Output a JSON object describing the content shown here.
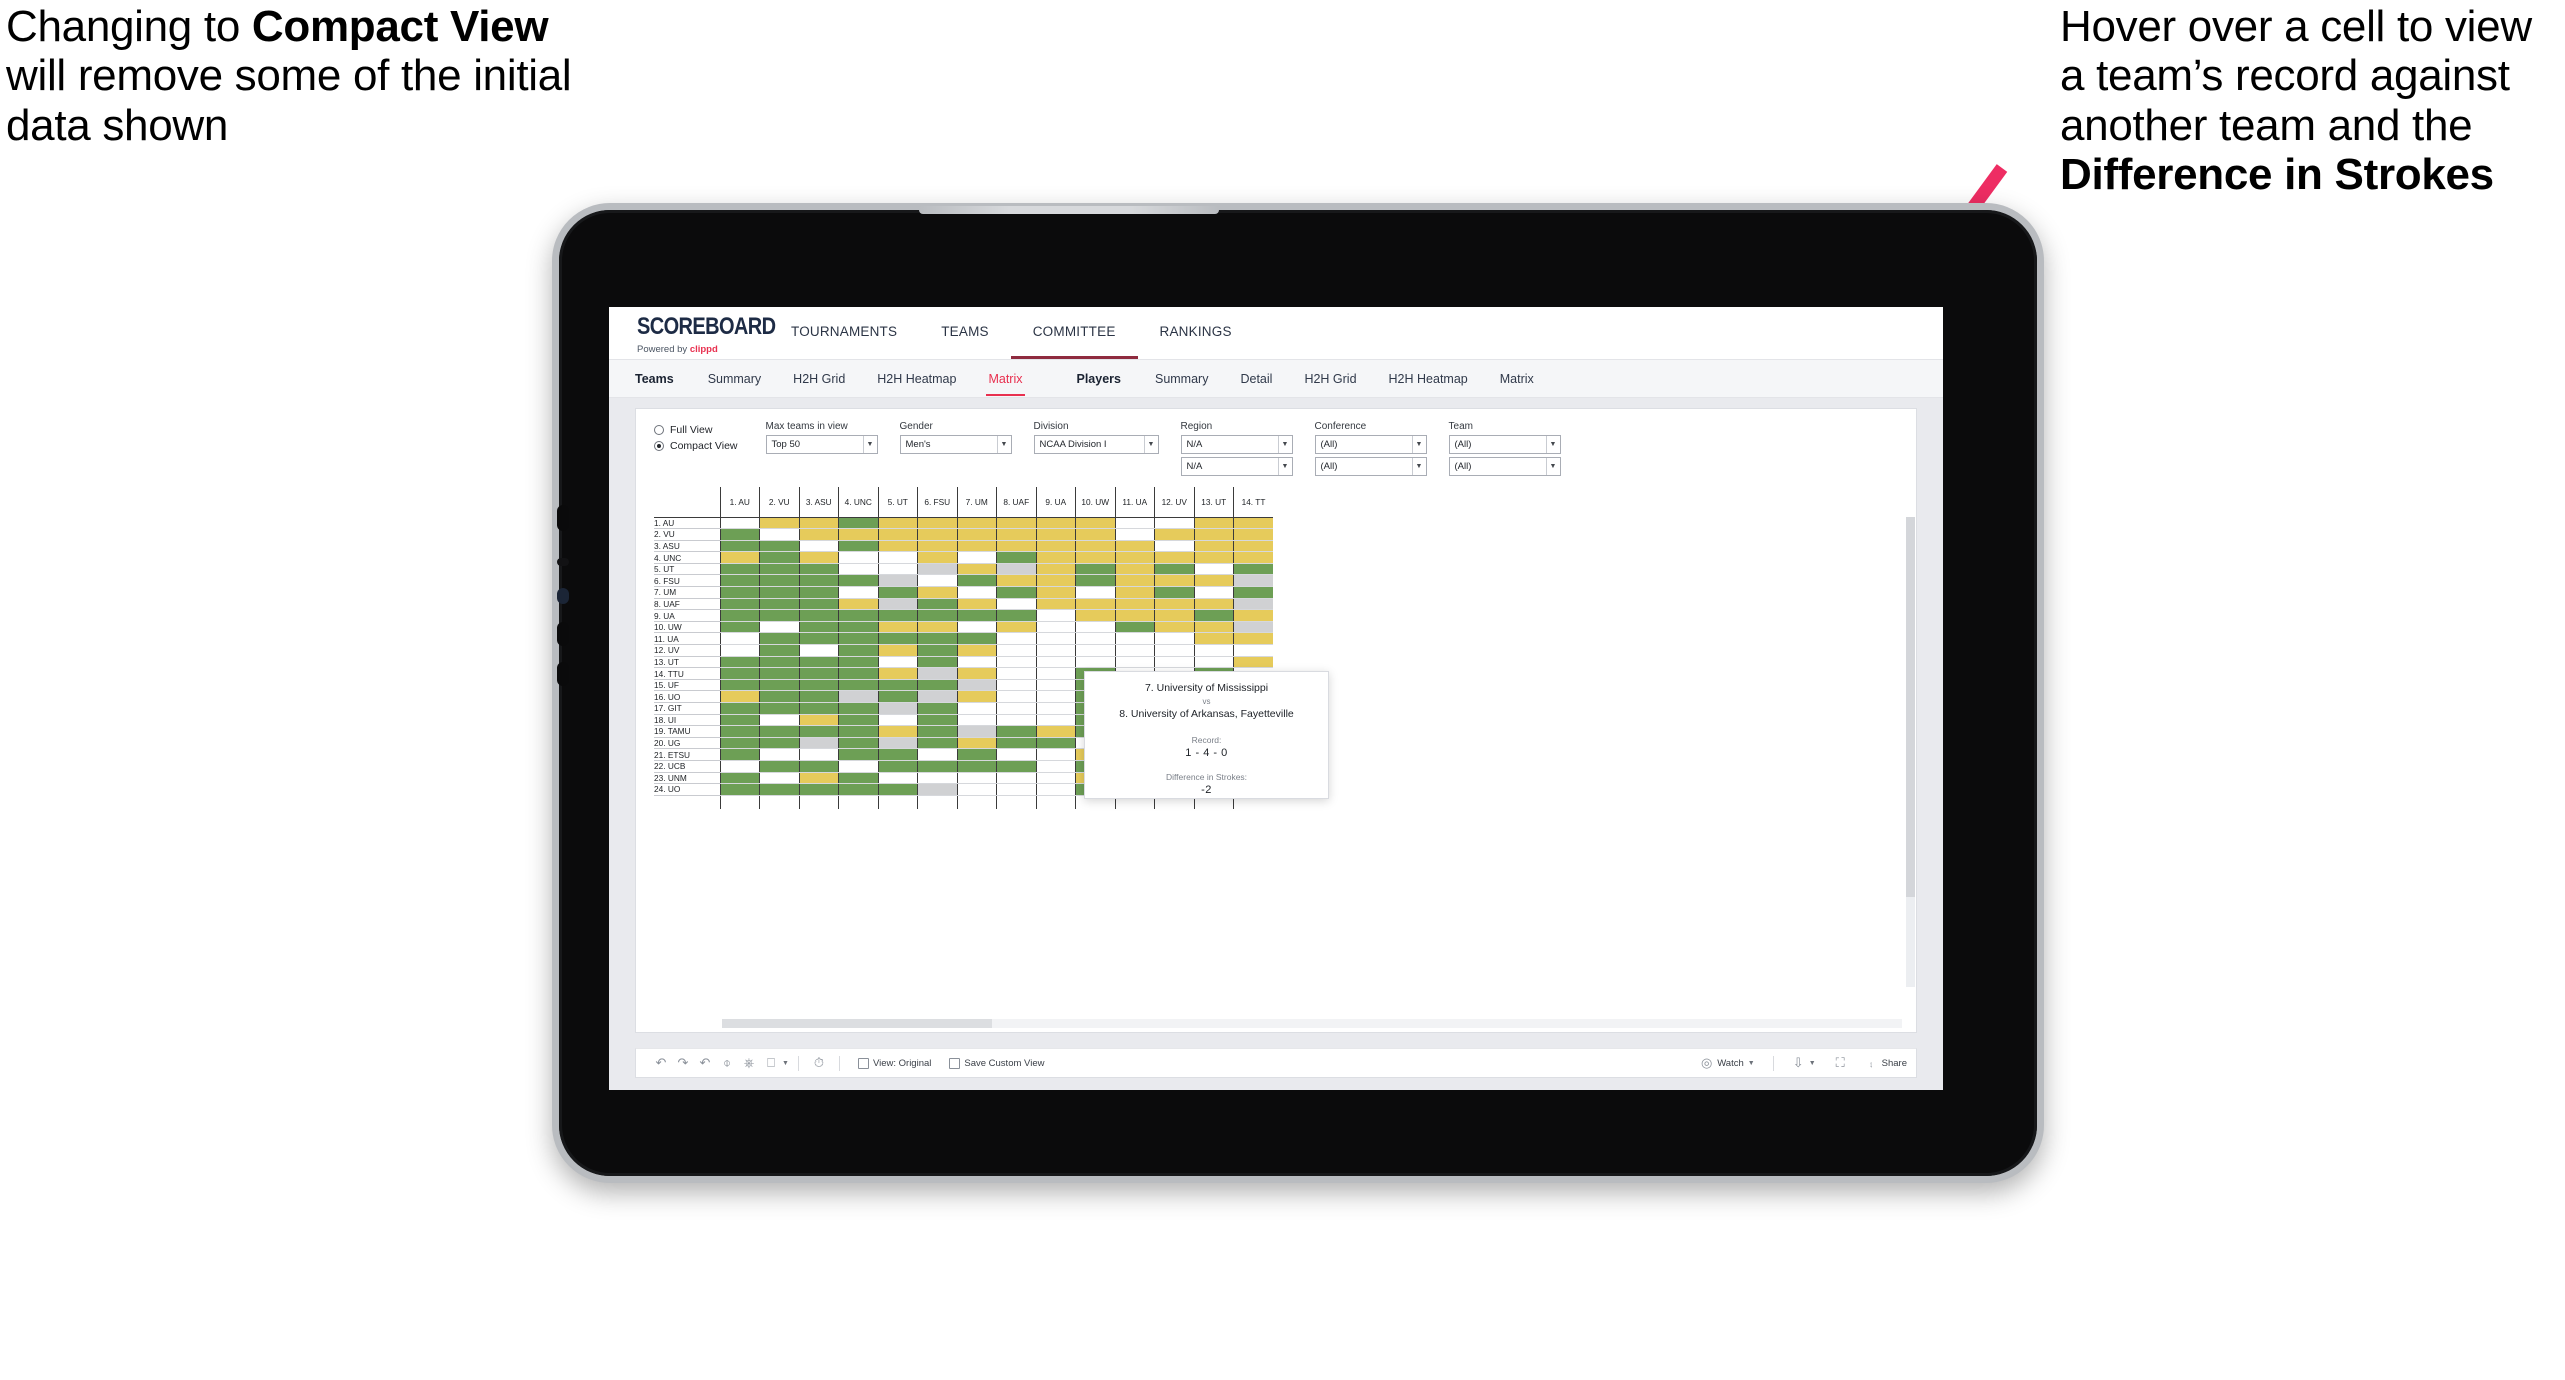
{
  "annotations": {
    "left": {
      "parts": [
        {
          "text": "Changing to ",
          "bold": false
        },
        {
          "text": "Compact View",
          "bold": true
        },
        {
          "text": " will remove some of the initial data shown",
          "bold": false
        }
      ]
    },
    "right": {
      "parts": [
        {
          "text": "Hover over a cell to view a team’s record against another team and the ",
          "bold": false
        },
        {
          "text": "Difference in Strokes",
          "bold": true
        }
      ]
    },
    "arrow_color": "#EE2D63"
  },
  "app": {
    "brand": {
      "name": "SCOREBOARD",
      "powered_prefix": "Powered by ",
      "powered_by": "clippd"
    },
    "top_nav": [
      {
        "label": "TOURNAMENTS",
        "active": false
      },
      {
        "label": "TEAMS",
        "active": false
      },
      {
        "label": "COMMITTEE",
        "active": true
      },
      {
        "label": "RANKINGS",
        "active": false
      }
    ],
    "sub_nav": {
      "teams_group": {
        "head": "Teams",
        "items": [
          {
            "label": "Summary",
            "selected": false
          },
          {
            "label": "H2H Grid",
            "selected": false
          },
          {
            "label": "H2H Heatmap",
            "selected": false
          },
          {
            "label": "Matrix",
            "selected": true
          }
        ]
      },
      "players_group": {
        "head": "Players",
        "items": [
          {
            "label": "Summary",
            "selected": false
          },
          {
            "label": "Detail",
            "selected": false
          },
          {
            "label": "H2H Grid",
            "selected": false
          },
          {
            "label": "H2H Heatmap",
            "selected": false
          },
          {
            "label": "Matrix",
            "selected": false
          }
        ]
      }
    }
  },
  "filters": {
    "view_mode": {
      "options": [
        {
          "label": "Full View",
          "selected": false
        },
        {
          "label": "Compact View",
          "selected": true
        }
      ]
    },
    "max_teams": {
      "label": "Max teams in view",
      "value": "Top 50"
    },
    "gender": {
      "label": "Gender",
      "value": "Men's"
    },
    "division": {
      "label": "Division",
      "value": "NCAA Division I"
    },
    "region": {
      "label": "Region",
      "value1": "N/A",
      "value2": "N/A"
    },
    "conference": {
      "label": "Conference",
      "value1": "(All)",
      "value2": "(All)"
    },
    "team": {
      "label": "Team",
      "value1": "(All)",
      "value2": "(All)"
    }
  },
  "tooltip": {
    "team_a": "7. University of Mississippi",
    "vs": "vs",
    "team_b": "8. University of Arkansas, Fayetteville",
    "record_label": "Record:",
    "record_value": "1 - 4 - 0",
    "strokes_label": "Difference in Strokes:",
    "strokes_value": "-2"
  },
  "toolbar": {
    "icons": [
      "undo-icon",
      "redo-icon",
      "revert-icon",
      "refresh-icon",
      "pause-icon",
      "highlight-icon"
    ],
    "view_original": "View: Original",
    "save_custom_view": "Save Custom View",
    "watch": "Watch",
    "share": "Share"
  },
  "chart_data": {
    "type": "heatmap",
    "title": "Teams H2H Matrix",
    "legend": {
      "green": "#6d9f55",
      "yellow": "#e6cb5b",
      "gray": "#d0d1d3",
      "white": "#ffffff"
    },
    "columns": [
      "1. AU",
      "2. VU",
      "3. ASU",
      "4. UNC",
      "5. UT",
      "6. FSU",
      "7. UM",
      "8. UAF",
      "9. UA",
      "10. UW",
      "11. UA",
      "12. UV",
      "13. UT",
      "14. TT"
    ],
    "rows": [
      "1. AU",
      "2. VU",
      "3. ASU",
      "4. UNC",
      "5. UT",
      "6. FSU",
      "7. UM",
      "8. UAF",
      "9. UA",
      "10. UW",
      "11. UA",
      "12. UV",
      "13. UT",
      "14. TTU",
      "15. UF",
      "16. UO",
      "17. GIT",
      "18. UI",
      "19. TAMU",
      "20. UG",
      "21. ETSU",
      "22. UCB",
      "23. UNM",
      "24. UO"
    ],
    "cells": [
      [
        "w",
        "y",
        "y",
        "g",
        "y",
        "y",
        "y",
        "y",
        "y",
        "y",
        "w",
        "w",
        "y",
        "y"
      ],
      [
        "g",
        "w",
        "y",
        "y",
        "y",
        "y",
        "y",
        "y",
        "y",
        "y",
        "w",
        "y",
        "y",
        "y"
      ],
      [
        "g",
        "g",
        "w",
        "g",
        "y",
        "y",
        "y",
        "y",
        "y",
        "y",
        "y",
        "w",
        "y",
        "y"
      ],
      [
        "y",
        "g",
        "y",
        "w",
        "w",
        "y",
        "w",
        "g",
        "y",
        "y",
        "y",
        "y",
        "y",
        "y"
      ],
      [
        "g",
        "g",
        "g",
        "w",
        "w",
        "a",
        "y",
        "a",
        "y",
        "g",
        "y",
        "g",
        "w",
        "g"
      ],
      [
        "g",
        "g",
        "g",
        "g",
        "a",
        "w",
        "g",
        "y",
        "y",
        "g",
        "y",
        "y",
        "y",
        "a"
      ],
      [
        "g",
        "g",
        "g",
        "w",
        "g",
        "y",
        "w",
        "g",
        "y",
        "w",
        "y",
        "g",
        "w",
        "g"
      ],
      [
        "g",
        "g",
        "g",
        "y",
        "a",
        "g",
        "y",
        "w",
        "y",
        "y",
        "y",
        "y",
        "y",
        "a"
      ],
      [
        "g",
        "g",
        "g",
        "g",
        "g",
        "g",
        "g",
        "g",
        "w",
        "y",
        "y",
        "y",
        "g",
        "y"
      ],
      [
        "g",
        "w",
        "g",
        "g",
        "y",
        "y",
        "w",
        "y",
        "w",
        "w",
        "g",
        "y",
        "y",
        "a"
      ],
      [
        "w",
        "g",
        "g",
        "g",
        "g",
        "g",
        "g",
        "w",
        "w",
        "w",
        "w",
        "w",
        "y",
        "y"
      ],
      [
        "w",
        "g",
        "w",
        "g",
        "y",
        "g",
        "y",
        "w",
        "w",
        "w",
        "w",
        "w",
        "w",
        "w"
      ],
      [
        "g",
        "g",
        "g",
        "g",
        "w",
        "g",
        "w",
        "w",
        "w",
        "w",
        "w",
        "w",
        "w",
        "y"
      ],
      [
        "g",
        "g",
        "g",
        "g",
        "y",
        "a",
        "y",
        "w",
        "w",
        "g",
        "w",
        "w",
        "g",
        "w"
      ],
      [
        "g",
        "g",
        "g",
        "g",
        "g",
        "g",
        "a",
        "w",
        "w",
        "g",
        "w",
        "w",
        "g",
        "w"
      ],
      [
        "y",
        "g",
        "g",
        "a",
        "g",
        "a",
        "y",
        "w",
        "w",
        "g",
        "w",
        "g",
        "y",
        "y"
      ],
      [
        "g",
        "g",
        "g",
        "g",
        "a",
        "g",
        "w",
        "w",
        "w",
        "g",
        "w",
        "w",
        "a",
        "y"
      ],
      [
        "g",
        "w",
        "y",
        "g",
        "w",
        "g",
        "w",
        "w",
        "w",
        "g",
        "w",
        "w",
        "g",
        "y"
      ],
      [
        "g",
        "g",
        "g",
        "g",
        "y",
        "g",
        "a",
        "g",
        "y",
        "g",
        "g",
        "g",
        "a",
        "y"
      ],
      [
        "g",
        "g",
        "a",
        "g",
        "a",
        "g",
        "y",
        "g",
        "g",
        "w",
        "w",
        "g",
        "a",
        "y"
      ],
      [
        "g",
        "w",
        "w",
        "g",
        "g",
        "w",
        "g",
        "w",
        "w",
        "y",
        "w",
        "g",
        "g",
        "w"
      ],
      [
        "w",
        "g",
        "g",
        "w",
        "g",
        "g",
        "g",
        "g",
        "w",
        "g",
        "y",
        "w",
        "y",
        "g"
      ],
      [
        "g",
        "w",
        "y",
        "g",
        "w",
        "w",
        "w",
        "w",
        "w",
        "y",
        "g",
        "w",
        "g",
        "y"
      ],
      [
        "g",
        "g",
        "g",
        "g",
        "g",
        "a",
        "w",
        "w",
        "w",
        "g",
        "y",
        "w",
        "y",
        "g"
      ]
    ]
  }
}
